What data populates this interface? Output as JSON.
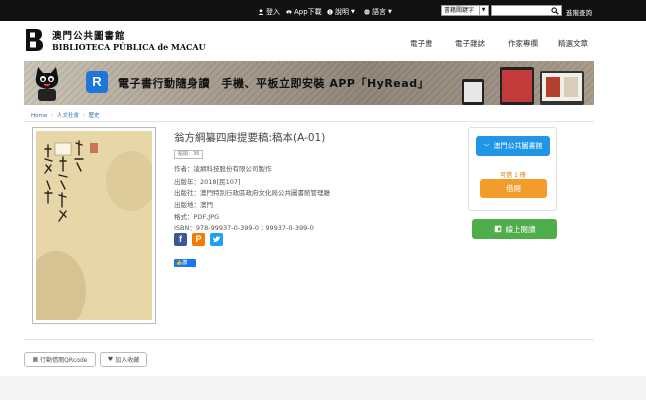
{
  "topbar": {
    "login": "登入",
    "app_download": "App下載",
    "help": "說明",
    "language": "語言",
    "search_type": "書籍關鍵字",
    "search_value": "",
    "advanced_search": "進階查詢"
  },
  "header": {
    "logo_cn": "澳門公共圖書館",
    "logo_pt": "BIBLIOTECA PÚBLICA de MACAU",
    "nav": [
      "電子書",
      "電子雜誌",
      "作家專欄",
      "精選文章"
    ]
  },
  "banner": {
    "app_letter": "R",
    "text": "電子書行動隨身讀　手機、平板立即安裝 APP「HyRead」"
  },
  "breadcrumb": [
    "Home",
    "人文社會",
    "歷史"
  ],
  "book": {
    "title": "翁方綱纂四庫提要稿:稿本(A-01)",
    "badge": "點閱：38",
    "author": "作者：凌網科技股份有限公司製作",
    "year": "出版年：2018[民107]",
    "publisher": "出版社：澳門特別行政區政府文化局公共圖書館管理廳",
    "place": "出版地：澳門",
    "format": "格式：PDF,JPG",
    "isbn": "ISBN：978-99937-0-399-0 ; 99937-0-399-0",
    "fb_like": "讚"
  },
  "sidebar": {
    "library_button": "澳門公共圖書館",
    "availability": "可借 1 冊",
    "borrow_button": "借閱",
    "read_online_button": "線上閱讀"
  },
  "footer_actions": {
    "qrcode": "行動借閱QRcode",
    "favorite": "加入收藏"
  },
  "colors": {
    "topbar": "#111111",
    "library_blue": "#2196e8",
    "borrow_orange": "#f39c2b",
    "read_green": "#4fae4a",
    "link": "#2a6fb3"
  }
}
